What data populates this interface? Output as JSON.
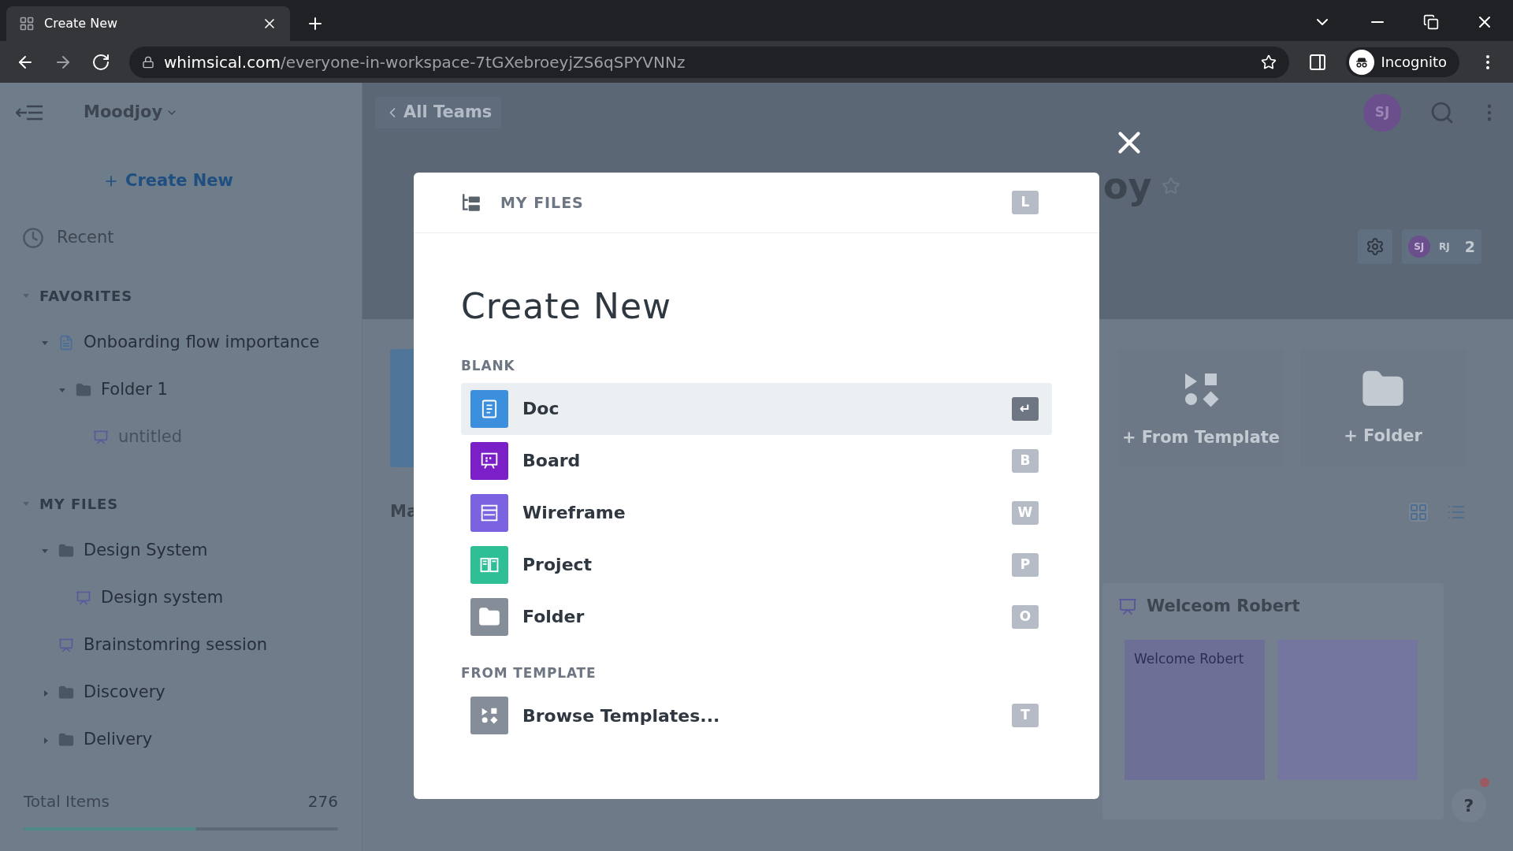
{
  "browser": {
    "tab_title": "Create New",
    "url_domain": "whimsical.com",
    "url_path": "/everyone-in-workspace-7tGXebroeyjZS6qSPYVNNz",
    "profile": "Incognito"
  },
  "sidebar": {
    "workspace": "Moodjoy",
    "create_new": "Create New",
    "recent": "Recent",
    "sections": [
      {
        "title": "FAVORITES",
        "expanded": true,
        "items": [
          {
            "label": "Onboarding flow importance",
            "kind": "doc",
            "expanded": true,
            "children": [
              {
                "label": "Folder 1",
                "kind": "folder",
                "expanded": true,
                "children": [
                  {
                    "label": "untitled",
                    "kind": "board",
                    "disabled": true
                  }
                ]
              }
            ]
          }
        ]
      },
      {
        "title": "MY FILES",
        "expanded": true,
        "items": [
          {
            "label": "Design System",
            "kind": "folder",
            "expanded": true,
            "children": [
              {
                "label": "Design system",
                "kind": "board",
                "disabled": false
              }
            ]
          },
          {
            "label": "Brainstomring session",
            "kind": "board",
            "disabled": false
          },
          {
            "label": "Discovery",
            "kind": "folder",
            "expanded": false
          },
          {
            "label": "Delivery",
            "kind": "folder",
            "expanded": false
          }
        ]
      }
    ],
    "total_label": "Total Items",
    "total_count": "276",
    "level": 0.55
  },
  "main": {
    "back_link": "All Teams",
    "avatar": "SJ",
    "title_fragment": "oy",
    "members": [
      "SJ",
      "RJ"
    ],
    "member_count": "2",
    "cards": [
      {
        "label": "+ From Template",
        "kind": "template"
      },
      {
        "label": "+ Folder",
        "kind": "folder"
      }
    ],
    "section_label": "Ma",
    "file_card": {
      "title": "Welceom Robert",
      "sticky_text": "Welcome Robert"
    },
    "help": "?"
  },
  "modal": {
    "header": "MY FILES",
    "header_key": "L",
    "title": "Create New",
    "groups": [
      {
        "title": "BLANK",
        "items": [
          {
            "label": "Doc",
            "kind": "doc",
            "key": "↵",
            "selected": true
          },
          {
            "label": "Board",
            "kind": "board",
            "key": "B",
            "selected": false
          },
          {
            "label": "Wireframe",
            "kind": "wireframe",
            "key": "W",
            "selected": false
          },
          {
            "label": "Project",
            "kind": "project",
            "key": "P",
            "selected": false
          },
          {
            "label": "Folder",
            "kind": "folder",
            "key": "O",
            "selected": false
          }
        ]
      },
      {
        "title": "FROM TEMPLATE",
        "items": [
          {
            "label": "Browse Templates...",
            "kind": "templates",
            "key": "T",
            "selected": false
          }
        ]
      }
    ]
  }
}
